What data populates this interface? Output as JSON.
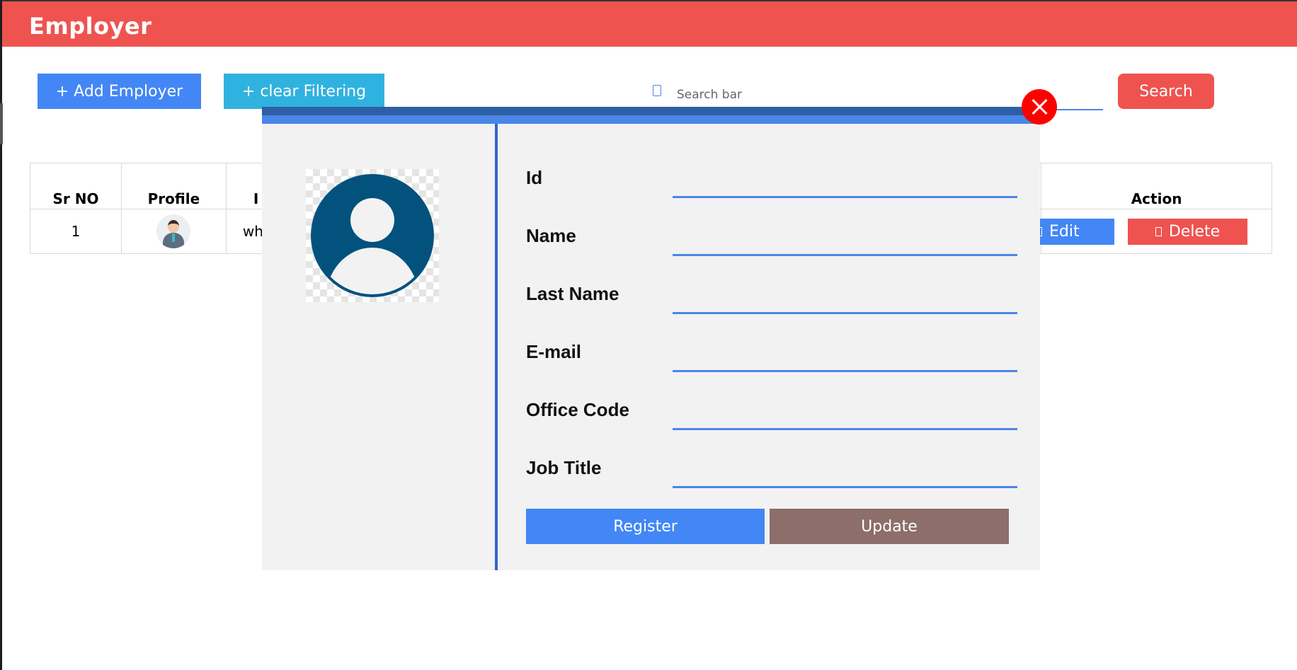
{
  "header": {
    "title": "Employer"
  },
  "toolbar": {
    "add_label": "+ Add Employer",
    "clear_label": "+ clear Filtering",
    "search_placeholder": "Search bar",
    "search_label": "Search"
  },
  "table": {
    "headers": [
      "Sr NO",
      "Profile",
      "I",
      "Action"
    ],
    "rows": [
      {
        "sr": "1",
        "id_partial": "wh",
        "edit_label": "Edit",
        "delete_label": "Delete"
      }
    ]
  },
  "modal": {
    "fields": [
      {
        "label": "Id"
      },
      {
        "label": "Name"
      },
      {
        "label": "Last Name"
      },
      {
        "label": "E-mail"
      },
      {
        "label": "Office Code"
      },
      {
        "label": "Job Title"
      }
    ],
    "register_label": "Register",
    "update_label": "Update"
  },
  "colors": {
    "header_red": "#ef5350",
    "primary_blue": "#4287f5",
    "cyan": "#30b2e0",
    "update_brown": "#8d6e6a",
    "avatar_blue": "#03527e"
  },
  "icons": [
    "search-icon",
    "close-icon",
    "user-avatar-icon",
    "edit-icon",
    "delete-icon"
  ]
}
